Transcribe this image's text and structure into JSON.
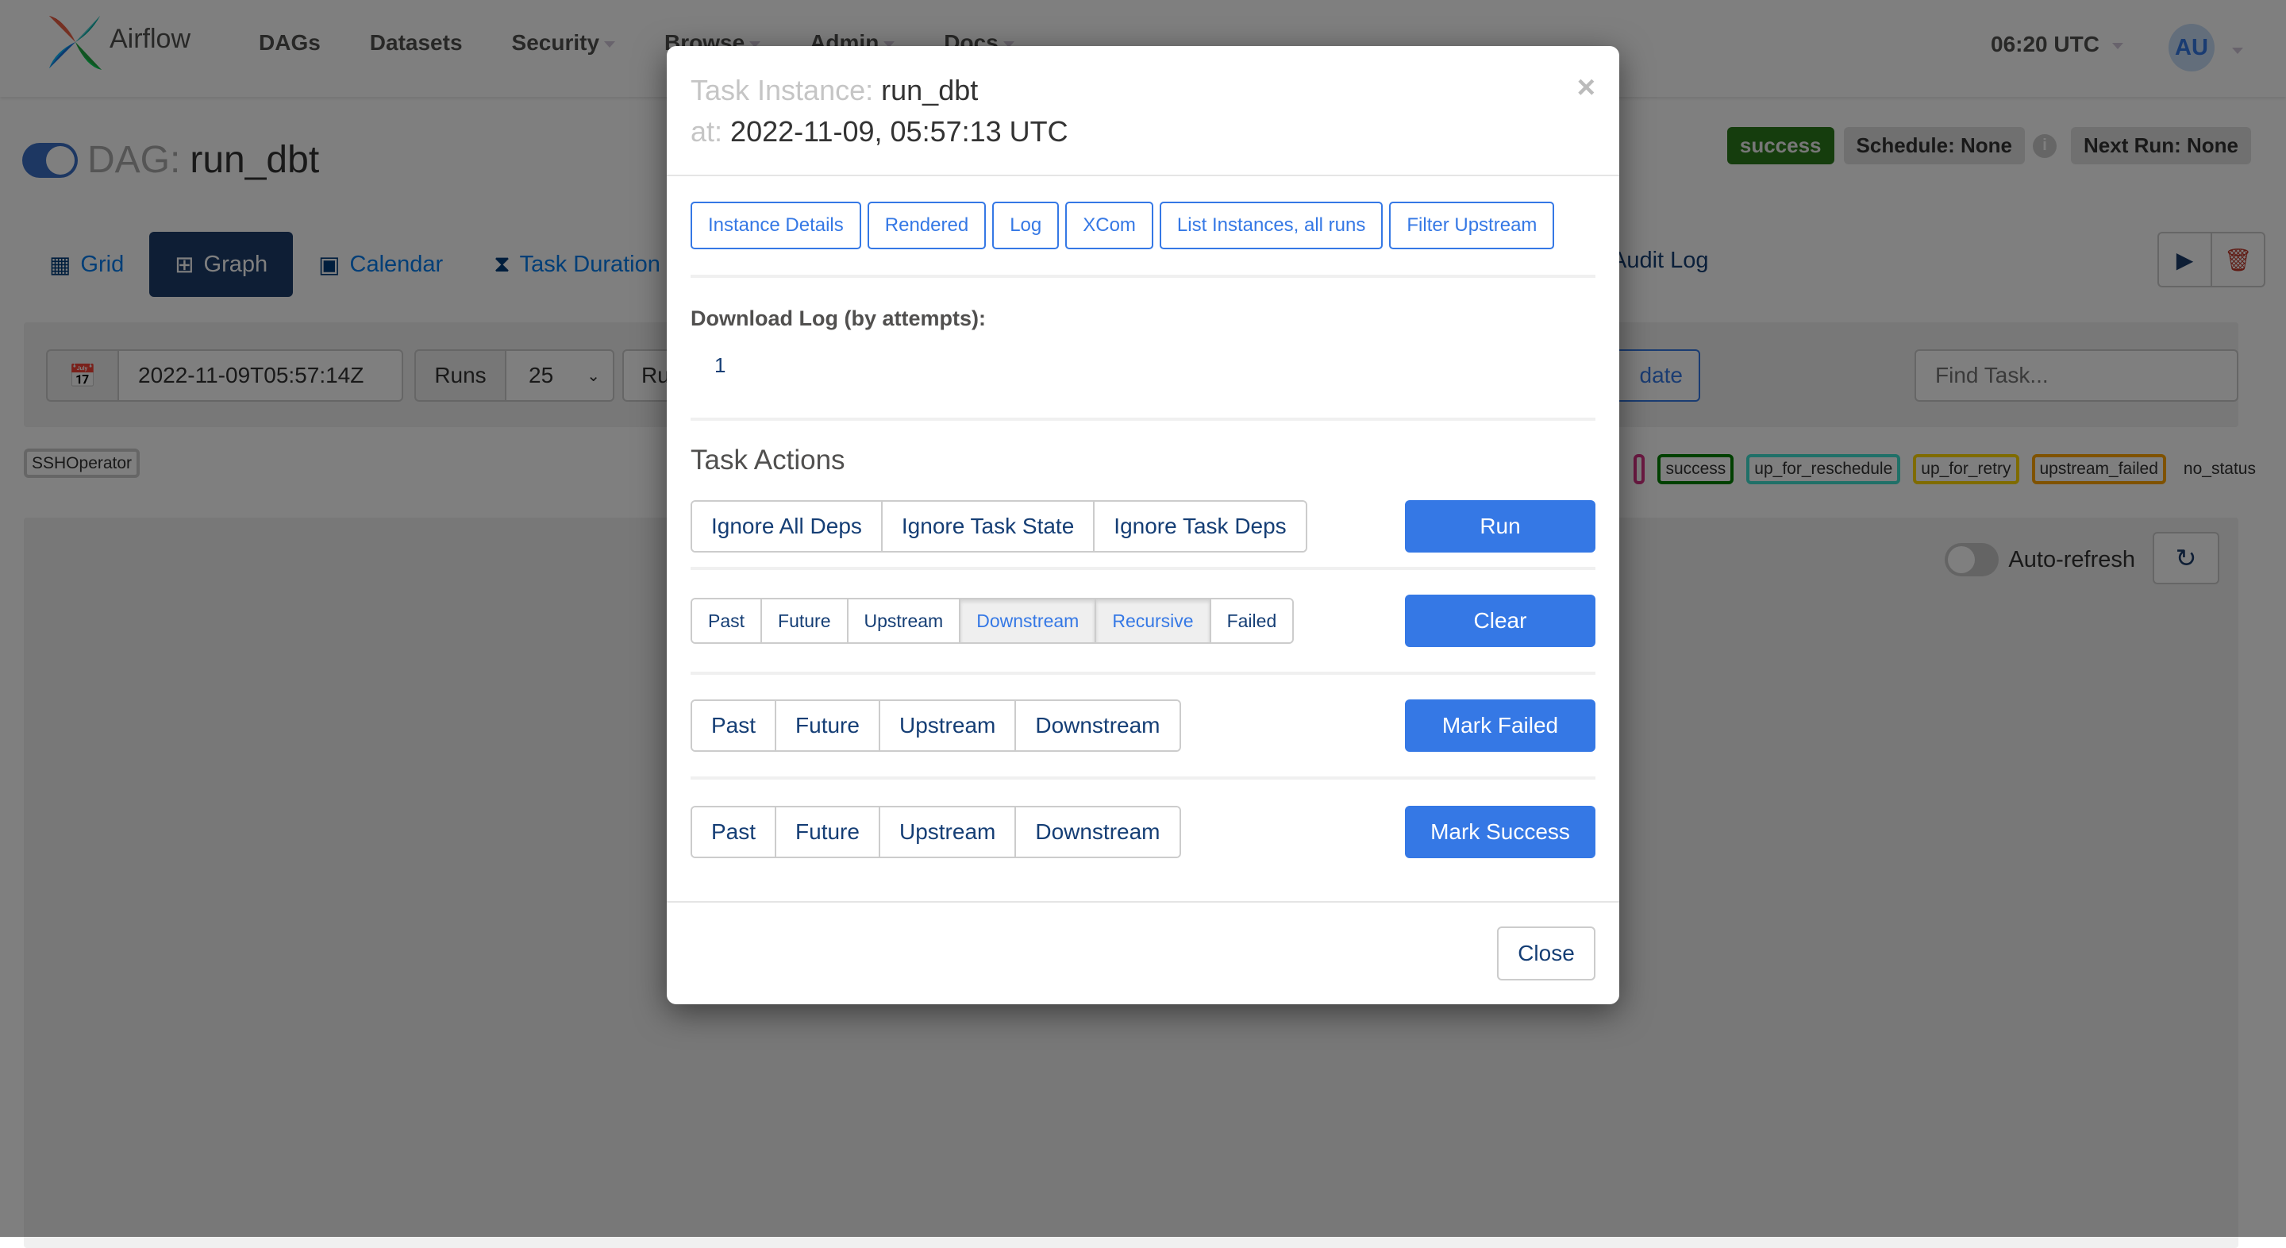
{
  "navbar": {
    "brand": "Airflow",
    "items": [
      {
        "label": "DAGs",
        "dropdown": false
      },
      {
        "label": "Datasets",
        "dropdown": false
      },
      {
        "label": "Security",
        "dropdown": true
      },
      {
        "label": "Browse",
        "dropdown": true
      },
      {
        "label": "Admin",
        "dropdown": true
      },
      {
        "label": "Docs",
        "dropdown": true
      }
    ],
    "clock": "06:20 UTC",
    "user_initials": "AU"
  },
  "dag": {
    "label": "DAG:",
    "name": "run_dbt",
    "paused": false,
    "status_badge": "success",
    "schedule": "Schedule: None",
    "next_run": "Next Run: None"
  },
  "tabs": [
    {
      "label": "Grid",
      "icon": "grid-icon",
      "active": false
    },
    {
      "label": "Graph",
      "icon": "graph-icon",
      "active": true
    },
    {
      "label": "Calendar",
      "icon": "calendar-icon",
      "active": false
    },
    {
      "label": "Task Duration",
      "icon": "hourglass-icon",
      "active": false
    }
  ],
  "audit_log_tab": "Audit Log",
  "filters": {
    "base_date": "2022-11-09T05:57:14Z",
    "runs_label": "Runs",
    "runs_value": "25",
    "run_partial": "Ru",
    "update_partial": "date",
    "find_task_placeholder": "Find Task..."
  },
  "legend": {
    "operator": "SSHOperator",
    "states": [
      {
        "label": "success",
        "color": "#008000"
      },
      {
        "label": "up_for_reschedule",
        "color": "#40e0d0"
      },
      {
        "label": "up_for_retry",
        "color": "#ffd700"
      },
      {
        "label": "upstream_failed",
        "color": "#ffa500"
      },
      {
        "label": "no_status",
        "color": null
      }
    ]
  },
  "graph": {
    "auto_refresh_label": "Auto-refresh",
    "auto_refresh_on": false
  },
  "modal": {
    "title_key": "Task Instance:",
    "title_value": "run_dbt",
    "at_key": "at:",
    "at_value": "2022-11-09, 05:57:13 UTC",
    "close_x": "×",
    "links": [
      "Instance Details",
      "Rendered",
      "Log",
      "XCom",
      "List Instances, all runs",
      "Filter Upstream"
    ],
    "download_log_label": "Download Log (by attempts):",
    "download_attempts": [
      "1"
    ],
    "task_actions_title": "Task Actions",
    "run_options": [
      "Ignore All Deps",
      "Ignore Task State",
      "Ignore Task Deps"
    ],
    "run_button": "Run",
    "clear_options": [
      {
        "label": "Past",
        "active": false
      },
      {
        "label": "Future",
        "active": false
      },
      {
        "label": "Upstream",
        "active": false
      },
      {
        "label": "Downstream",
        "active": true
      },
      {
        "label": "Recursive",
        "active": true
      },
      {
        "label": "Failed",
        "active": false
      }
    ],
    "clear_button": "Clear",
    "mark_failed_options": [
      "Past",
      "Future",
      "Upstream",
      "Downstream"
    ],
    "mark_failed_button": "Mark Failed",
    "mark_success_options": [
      "Past",
      "Future",
      "Upstream",
      "Downstream"
    ],
    "mark_success_button": "Mark Success",
    "close_button": "Close"
  },
  "colors": {
    "primary": "#3578e5",
    "navy": "#1d3d6b",
    "success_badge": "#2b7a1a"
  }
}
